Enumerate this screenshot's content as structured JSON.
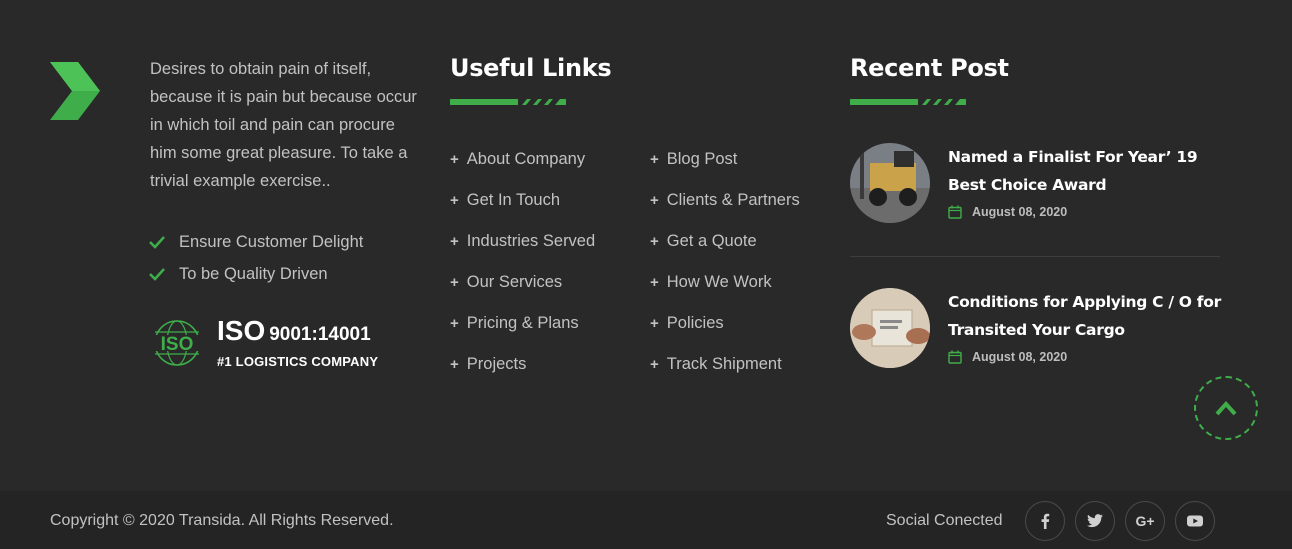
{
  "about": {
    "text": "Desires to obtain pain of itself, because it is pain but because occur in which toil and pain can procure him some great pleasure. To take a trivial example exercise..",
    "checks": [
      "Ensure Customer Delight",
      "To be Quality Driven"
    ],
    "iso_badge": "ISO",
    "iso_title": "ISO",
    "iso_number": "9001:14001",
    "iso_tagline": "#1 LOGISTICS COMPANY"
  },
  "useful_links": {
    "heading": "Useful Links",
    "col1": [
      "About Company",
      "Get In Touch",
      "Industries Served",
      "Our Services",
      "Pricing & Plans",
      "Projects"
    ],
    "col2": [
      "Blog Post",
      "Clients & Partners",
      "Get a Quote",
      "How We Work",
      "Policies",
      "Track Shipment"
    ],
    "bullet": "+"
  },
  "recent_post": {
    "heading": "Recent Post",
    "posts": [
      {
        "title": "Named a Finalist For Year’ 19 Best Choice Award",
        "date": "August 08, 2020"
      },
      {
        "title": "Conditions for Applying C / O for Transited Your Cargo",
        "date": "August 08, 2020"
      }
    ]
  },
  "bottom": {
    "copyright": "Copyright © 2020 Transida. All Rights Reserved.",
    "social_label": "Social Conected",
    "social_icons": [
      "facebook-icon",
      "twitter-icon",
      "google-plus-icon",
      "youtube-icon"
    ],
    "gplus_text": "G+"
  },
  "colors": {
    "accent": "#3fae4a",
    "background": "#292929",
    "bottom_bar": "#242424"
  }
}
